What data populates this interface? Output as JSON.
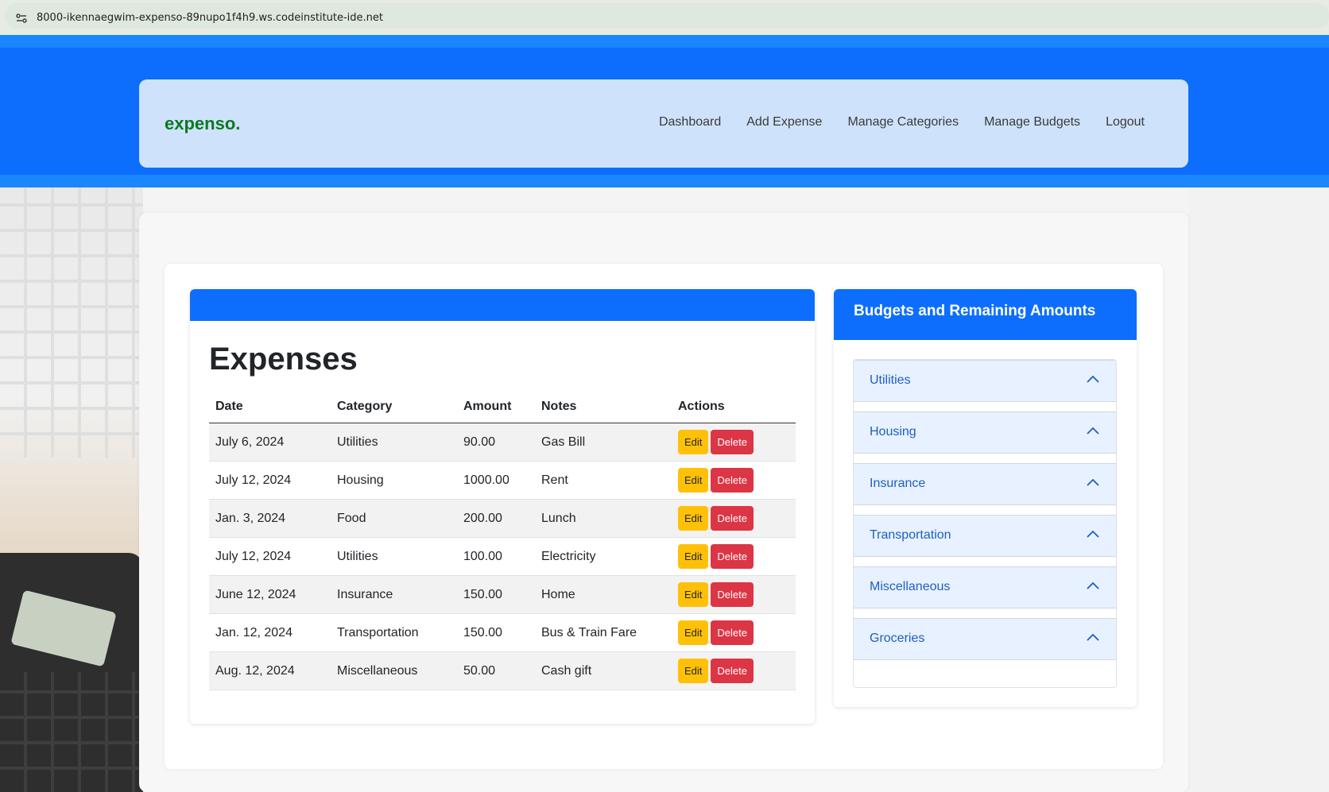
{
  "browser": {
    "url": "8000-ikennaegwim-expenso-89nupo1f4h9.ws.codeinstitute-ide.net",
    "site_icon": "site-info-icon"
  },
  "navbar": {
    "brand": "expenso.",
    "links": [
      "Dashboard",
      "Add Expense",
      "Manage Categories",
      "Manage Budgets",
      "Logout"
    ]
  },
  "expenses": {
    "title": "Expenses",
    "columns": [
      "Date",
      "Category",
      "Amount",
      "Notes",
      "Actions"
    ],
    "edit_label": "Edit",
    "delete_label": "Delete",
    "rows": [
      {
        "date": "July 6, 2024",
        "category": "Utilities",
        "amount": "90.00",
        "notes": "Gas Bill"
      },
      {
        "date": "July 12, 2024",
        "category": "Housing",
        "amount": "1000.00",
        "notes": "Rent"
      },
      {
        "date": "Jan. 3, 2024",
        "category": "Food",
        "amount": "200.00",
        "notes": "Lunch"
      },
      {
        "date": "July 12, 2024",
        "category": "Utilities",
        "amount": "100.00",
        "notes": "Electricity"
      },
      {
        "date": "June 12, 2024",
        "category": "Insurance",
        "amount": "150.00",
        "notes": "Home"
      },
      {
        "date": "Jan. 12, 2024",
        "category": "Transportation",
        "amount": "150.00",
        "notes": "Bus & Train Fare"
      },
      {
        "date": "Aug. 12, 2024",
        "category": "Miscellaneous",
        "amount": "50.00",
        "notes": "Cash gift"
      }
    ]
  },
  "budgets": {
    "title": "Budgets and Remaining Amounts",
    "items": [
      "Utilities",
      "Housing",
      "Insurance",
      "Transportation",
      "Miscellaneous",
      "Groceries"
    ]
  },
  "colors": {
    "primary": "#0d6efd",
    "navbar_bg": "#cfe2fb",
    "brand": "#0a7a20",
    "edit": "#ffc107",
    "delete": "#dc3545",
    "accordion_bg": "#e7f1ff",
    "accordion_text": "#1f5fc0"
  }
}
